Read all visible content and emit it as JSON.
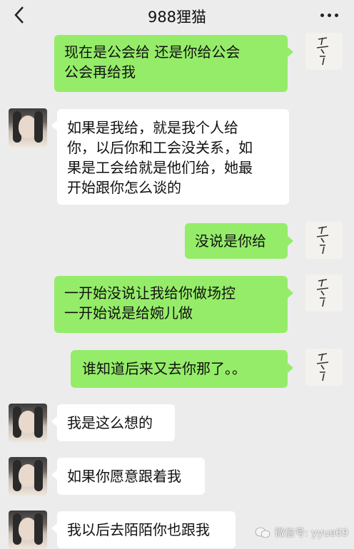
{
  "header": {
    "title": "988狸猫",
    "back_icon": "chevron-left-icon",
    "more_icon": "more-dots-icon"
  },
  "messages": [
    {
      "side": "out",
      "text": "现在是公会给 还是你给公会\n公会再给我"
    },
    {
      "side": "in",
      "text": "如果是我给，就是我个人给\n你，以后你和工会没关系，如\n果是工会给就是他们给，她最\n开始跟你怎么谈的"
    },
    {
      "side": "out",
      "text": "没说是你给"
    },
    {
      "side": "out",
      "text": "一开始没说让我给你做场控\n一开始说是给婉儿做"
    },
    {
      "side": "out",
      "text": "谁知道后来又去你那了。。"
    },
    {
      "side": "in",
      "text": "我是这么想的"
    },
    {
      "side": "in",
      "text": "如果你愿意跟着我"
    },
    {
      "side": "in",
      "text": "我以后去陌陌你也跟我"
    }
  ],
  "watermark": {
    "text": "微信号: yyue69",
    "icon": "wechat-icon"
  },
  "colors": {
    "outgoing": "#95ec69",
    "incoming": "#ffffff",
    "background": "#ececec"
  }
}
